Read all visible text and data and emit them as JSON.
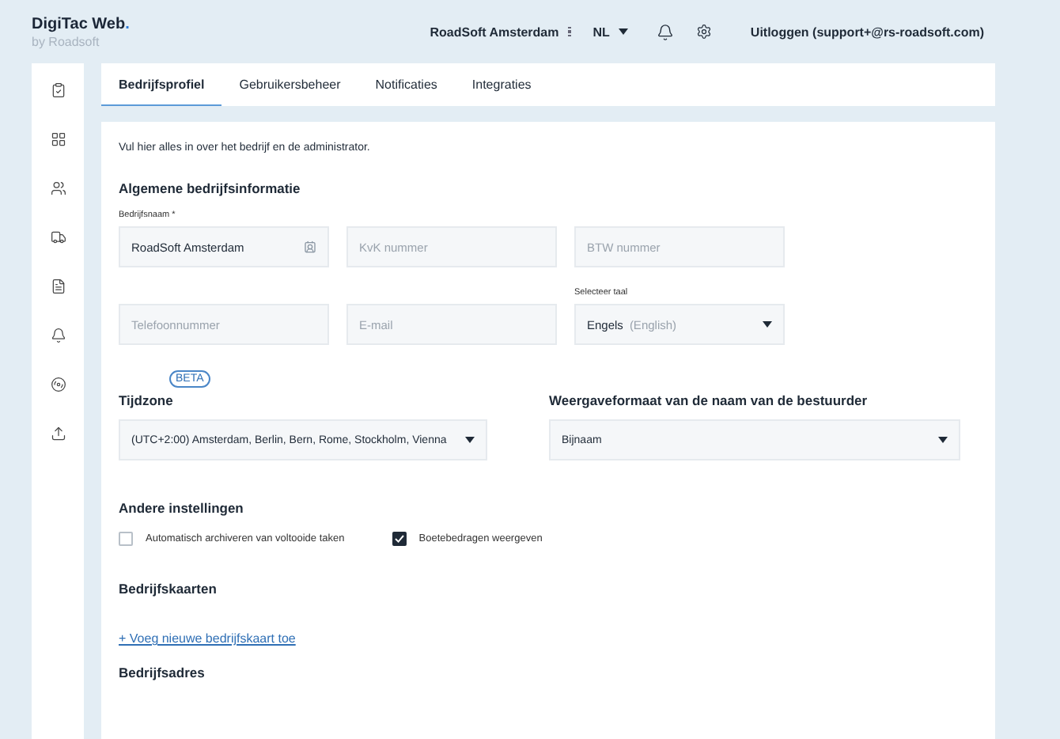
{
  "header": {
    "logo": "DigiTac Web",
    "logo_dot": ".",
    "logo_sub": "by Roadsoft",
    "company": "RoadSoft Amsterdam",
    "language": "NL",
    "logout": "Uitloggen (support+@rs-roadsoft.com)"
  },
  "tabs": [
    {
      "label": "Bedrijfsprofiel",
      "selected": true
    },
    {
      "label": "Gebruikersbeheer",
      "selected": false
    },
    {
      "label": "Notificaties",
      "selected": false
    },
    {
      "label": "Integraties",
      "selected": false
    }
  ],
  "intro": "Vul hier alles in over het bedrijf en de administrator.",
  "general": {
    "heading": "Algemene bedrijfsinformatie",
    "fields": [
      {
        "kind": "input",
        "label": "Bedrijfsnaam *",
        "value": "RoadSoft Amsterdam"
      },
      {
        "kind": "input",
        "placeholder": "KvK nummer"
      },
      {
        "kind": "input",
        "placeholder": "BTW nummer"
      },
      {
        "kind": "input",
        "placeholder": "Telefoonnummer"
      },
      {
        "kind": "input",
        "placeholder": "E-mail"
      },
      {
        "kind": "select",
        "label": "Selecteer taal",
        "value": "Engels",
        "hint": "(English)"
      }
    ]
  },
  "timezone": {
    "badge": "BETA",
    "heading": "Tijdzone",
    "value": "(UTC+2:00) Amsterdam, Berlin, Bern, Rome, Stockholm, Vienna"
  },
  "driver_name_format": {
    "heading": "Weergaveformaat van de naam van de bestuurder",
    "value": "Bijnaam"
  },
  "other_settings": {
    "heading": "Andere instellingen",
    "options": [
      {
        "label": "Automatisch archiveren van voltooide taken",
        "checked": false
      },
      {
        "label": "Boetebedragen weergeven",
        "checked": true
      }
    ]
  },
  "company_cards": {
    "heading": "Bedrijfskaarten",
    "add_link": "+ Voeg nieuwe bedrijfskaart toe"
  },
  "company_address": {
    "heading": "Bedrijfsadres"
  }
}
